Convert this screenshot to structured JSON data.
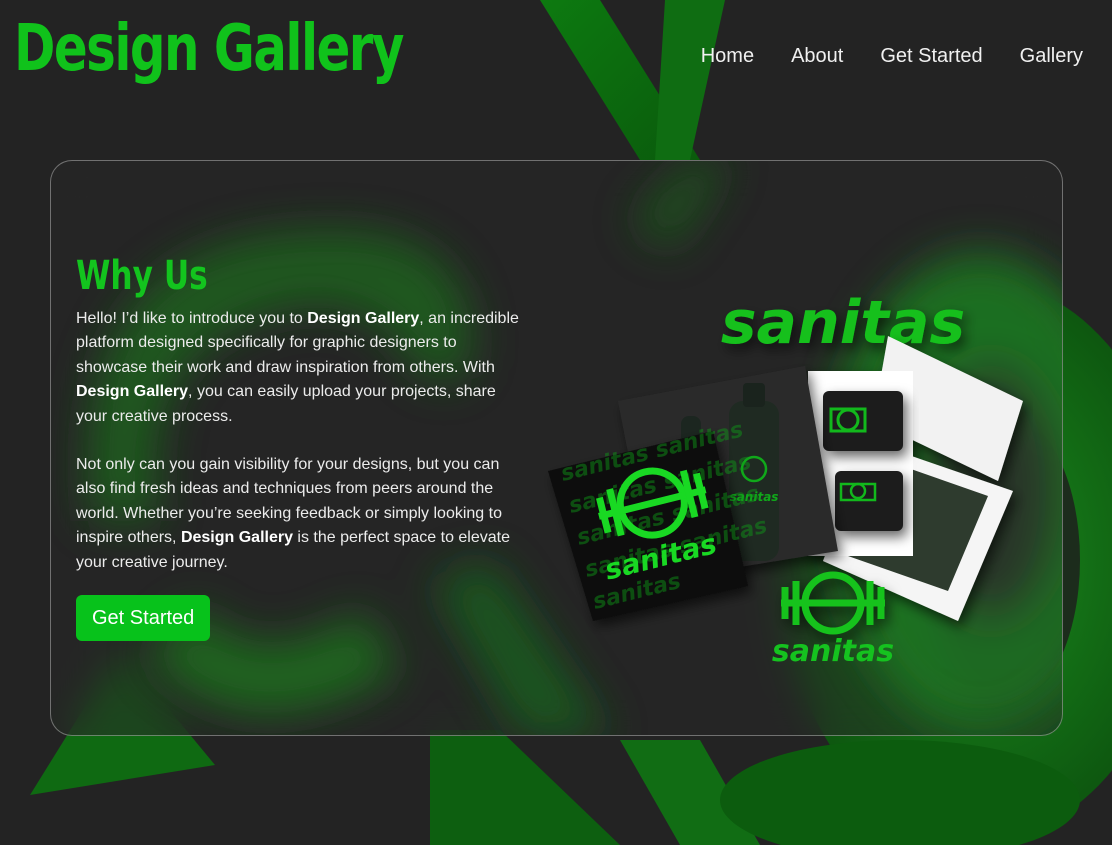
{
  "header": {
    "logo_text": "Design Gallery",
    "nav": [
      "Home",
      "About",
      "Get Started",
      "Gallery"
    ]
  },
  "why": {
    "title": "Why Us",
    "p1_a": "Hello! I’d like to introduce you to ",
    "p1_b": "Design Gallery",
    "p1_c": ", an incredible platform designed specifically for graphic designers to showcase their work and draw inspiration from others. With ",
    "p1_d": "Design Gallery",
    "p1_e": ", you can easily upload your projects, share your creative process.",
    "p2_a": "Not only can you gain visibility for your designs, but you can also find fresh ideas and techniques from peers around the world. Whether you’re seeking feedback or simply looking to inspire others, ",
    "p2_b": "Design Gallery",
    "p2_c": " is the perfect space to elevate your creative journey.",
    "cta_label": "Get Started"
  },
  "mockup": {
    "brand_text": "sanitas"
  },
  "colors": {
    "accent": "#10c21b",
    "background": "#232323",
    "button": "#07c21b"
  }
}
